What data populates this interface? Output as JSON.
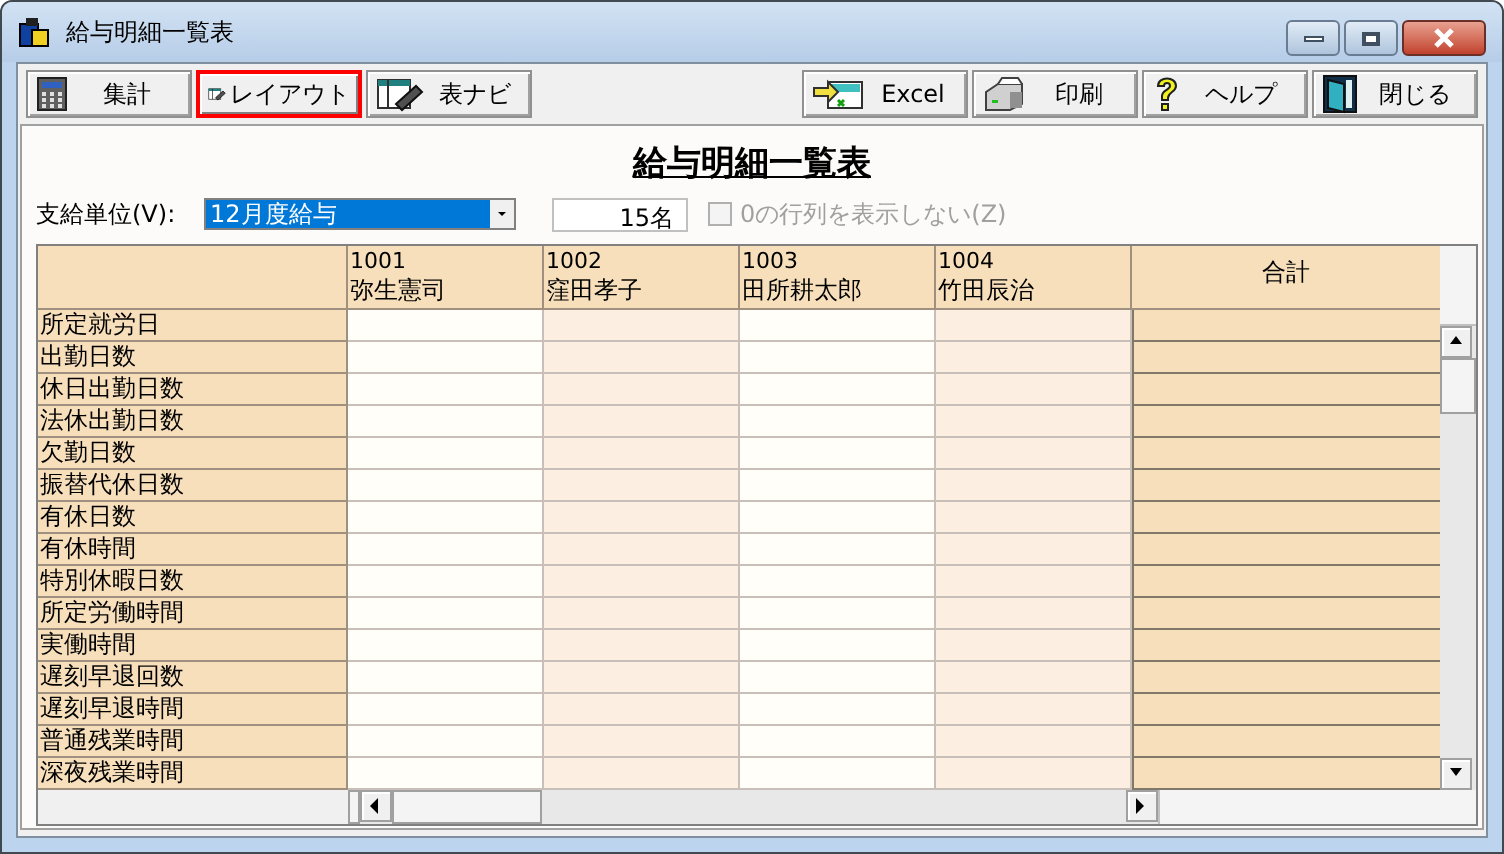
{
  "window": {
    "title": "給与明細一覧表"
  },
  "toolbar_left": [
    {
      "kind": "calculator",
      "label": "集計",
      "highlighted": false
    },
    {
      "kind": "layout",
      "label": "レイアウト",
      "highlighted": true
    },
    {
      "kind": "layout",
      "label": "表ナビ",
      "highlighted": false
    }
  ],
  "toolbar_right": [
    {
      "kind": "excel",
      "label": "Excel",
      "highlighted": false
    },
    {
      "kind": "printer",
      "label": "印刷",
      "highlighted": false
    },
    {
      "kind": "help",
      "label": "ヘルプ",
      "highlighted": false
    },
    {
      "kind": "door",
      "label": "閉じる",
      "highlighted": false
    }
  ],
  "heading": "給与明細一覧表",
  "pay_unit": {
    "label": "支給単位(V):",
    "value": "12月度給与"
  },
  "count": "15名",
  "hide_zero": {
    "label": "0の行列を表示しない(Z)",
    "checked": false,
    "disabled": true
  },
  "grid": {
    "columns": [
      {
        "code": "1001",
        "name": "弥生憲司"
      },
      {
        "code": "1002",
        "name": "窪田孝子"
      },
      {
        "code": "1003",
        "name": "田所耕太郎"
      },
      {
        "code": "1004",
        "name": "竹田辰治"
      }
    ],
    "total_header": "合計",
    "rows": [
      "所定就労日",
      "出勤日数",
      "休日出勤日数",
      "法休出勤日数",
      "欠勤日数",
      "振替代休日数",
      "有休日数",
      "有休時間",
      "特別休暇日数",
      "所定労働時間",
      "実働時間",
      "遅刻早退回数",
      "遅刻早退時間",
      "普通残業時間",
      "深夜残業時間"
    ]
  }
}
